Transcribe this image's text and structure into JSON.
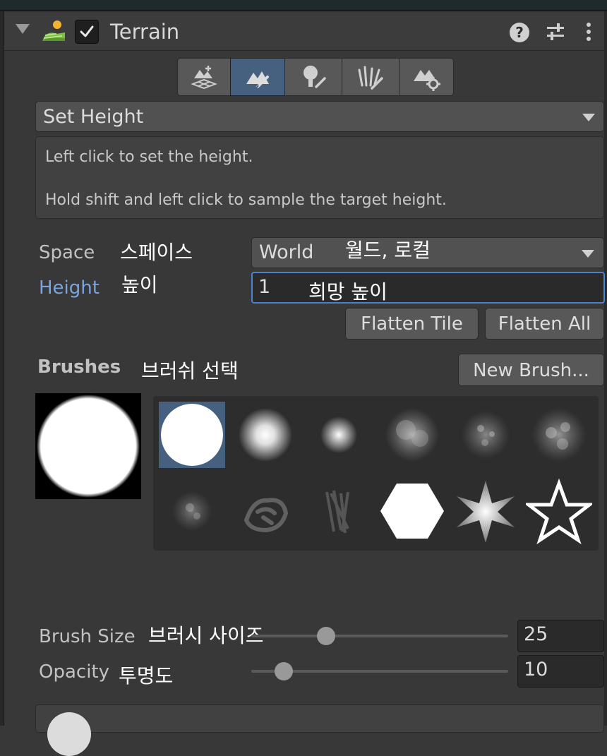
{
  "header": {
    "title": "Terrain",
    "help_glyph": "?"
  },
  "toolbar": {
    "tools": [
      {
        "icon": "create-neighbor-terrains-icon",
        "active": false
      },
      {
        "icon": "paint-terrain-icon",
        "active": true
      },
      {
        "icon": "paint-trees-icon",
        "active": false
      },
      {
        "icon": "paint-details-icon",
        "active": false
      },
      {
        "icon": "terrain-settings-icon",
        "active": false
      }
    ]
  },
  "tool_select": {
    "value": "Set Height"
  },
  "help": {
    "line1": "Left click to set the height.",
    "line2": "Hold shift and left click to sample the target height."
  },
  "space": {
    "label": "Space",
    "annotation": "스페이스",
    "value": "World",
    "value_annotation": "월드, 로컬"
  },
  "height": {
    "label": "Height",
    "annotation": "높이",
    "value": "1",
    "value_annotation": "희망 높이"
  },
  "buttons": {
    "flatten_tile": "Flatten Tile",
    "flatten_all": "Flatten All",
    "new_brush": "New Brush..."
  },
  "brushes": {
    "label": "Brushes",
    "annotation": "브러쉬 선택",
    "selected_index": 0,
    "items": [
      "hard-circle-brush",
      "soft-circle-brush",
      "small-soft-brush",
      "cloud-brush-1",
      "noise-brush-1",
      "cloud-brush-2",
      "noise-brush-2",
      "cell-brush",
      "streak-brush",
      "hexagon-brush",
      "star-burst-brush",
      "star-outline-brush"
    ]
  },
  "brush_size": {
    "label": "Brush Size",
    "annotation": "브러시 사이즈",
    "value": "25"
  },
  "opacity": {
    "label": "Opacity",
    "annotation": "투명도",
    "value": "10"
  },
  "colors": {
    "accent_blue": "#46607f",
    "height_label": "#7ba3e0",
    "panel_bg": "#383838"
  }
}
